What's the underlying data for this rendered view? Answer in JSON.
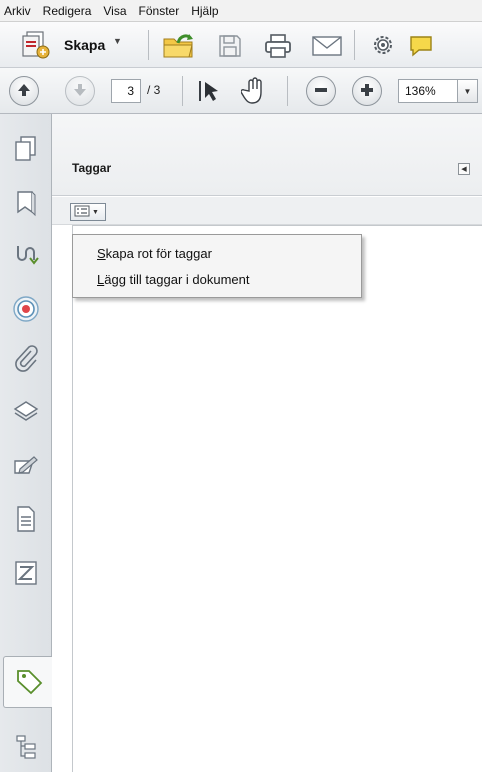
{
  "menubar": {
    "items": [
      "Arkiv",
      "Redigera",
      "Visa",
      "Fönster",
      "Hjälp"
    ]
  },
  "toolbar": {
    "create_label": "Skapa",
    "icons": [
      "create-pdf-icon",
      "open-folder-icon",
      "save-icon",
      "print-icon",
      "email-icon",
      "settings-icon",
      "comment-icon"
    ]
  },
  "navigation": {
    "current_page": "3",
    "total_pages": "/ 3",
    "zoom": "136%"
  },
  "sidebar": {
    "items": [
      "pages-icon",
      "bookmarks-icon",
      "signatures-icon",
      "layers-target-icon",
      "attachments-icon",
      "layers-icon",
      "sign-icon",
      "content-icon",
      "order-icon",
      "tags-icon",
      "model-tree-icon"
    ],
    "active": "tags-icon"
  },
  "panel": {
    "title": "Taggar"
  },
  "options_menu": {
    "items": [
      {
        "mnemonic": "S",
        "rest": "kapa rot för taggar"
      },
      {
        "mnemonic": "L",
        "rest": "ägg till taggar i dokument"
      }
    ]
  },
  "colors": {
    "accent_green": "#5a8f2c",
    "icon_gray": "#6b7580",
    "panel_bg": "#ffffff"
  }
}
